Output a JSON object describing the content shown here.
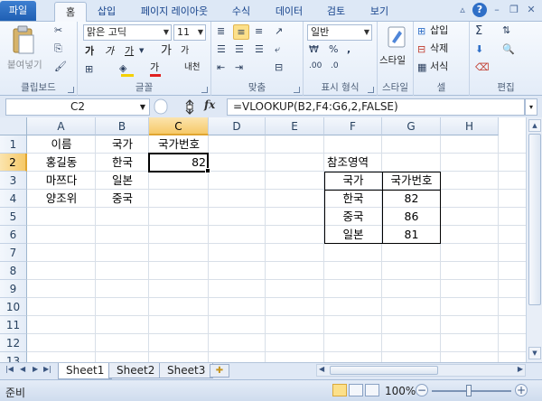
{
  "tabs": [
    {
      "label": "파일",
      "x": 0
    },
    {
      "label": "홈",
      "x": 0
    },
    {
      "label": "삽입",
      "x": 0
    },
    {
      "label": "페이지 레이아웃",
      "x": 0
    },
    {
      "label": "수식",
      "x": 0
    },
    {
      "label": "데이터",
      "x": 0
    },
    {
      "label": "검토",
      "x": 0
    },
    {
      "label": "보기",
      "x": 0
    }
  ],
  "ribbon": {
    "clipboard": {
      "label": "클립보드",
      "paste": "붙여넣기"
    },
    "font": {
      "label": "글꼴",
      "font_name": "맑은 고딕",
      "font_size": "11",
      "bold": "가",
      "italic": "가",
      "underline": "가",
      "grow": "가",
      "shrink": "가",
      "phonetic": "내천"
    },
    "alignment": {
      "label": "맞춤"
    },
    "number": {
      "label": "표시 형식",
      "format": "일반"
    },
    "styles": {
      "label": "스타일",
      "button": "스타일"
    },
    "cells": {
      "label": "셀",
      "insert": "삽입",
      "delete": "삭제",
      "format": "서식"
    },
    "editing": {
      "label": "편집"
    }
  },
  "formula_bar": {
    "name_box": "C2",
    "fx": "fx",
    "formula": "=VLOOKUP(B2,F4:G6,2,FALSE)"
  },
  "columns": [
    "A",
    "B",
    "C",
    "D",
    "E",
    "F",
    "G",
    "H"
  ],
  "rows": [
    "1",
    "2",
    "3",
    "4",
    "5",
    "6",
    "7",
    "8",
    "9",
    "10",
    "11",
    "12",
    "13"
  ],
  "cells": {
    "A1": "이름",
    "B1": "국가",
    "C1": "국가번호",
    "A2": "홍길동",
    "B2": "한국",
    "C2": "82",
    "A3": "마쯔다",
    "B3": "일본",
    "A4": "양조위",
    "B4": "중국",
    "F2": "참조영역",
    "F3": "국가",
    "G3": "국가번호",
    "F4": "한국",
    "G4": "82",
    "F5": "중국",
    "G5": "86",
    "F6": "일본",
    "G6": "81"
  },
  "sheets": [
    "Sheet1",
    "Sheet2",
    "Sheet3"
  ],
  "status": {
    "ready": "준비",
    "zoom": "100%"
  }
}
